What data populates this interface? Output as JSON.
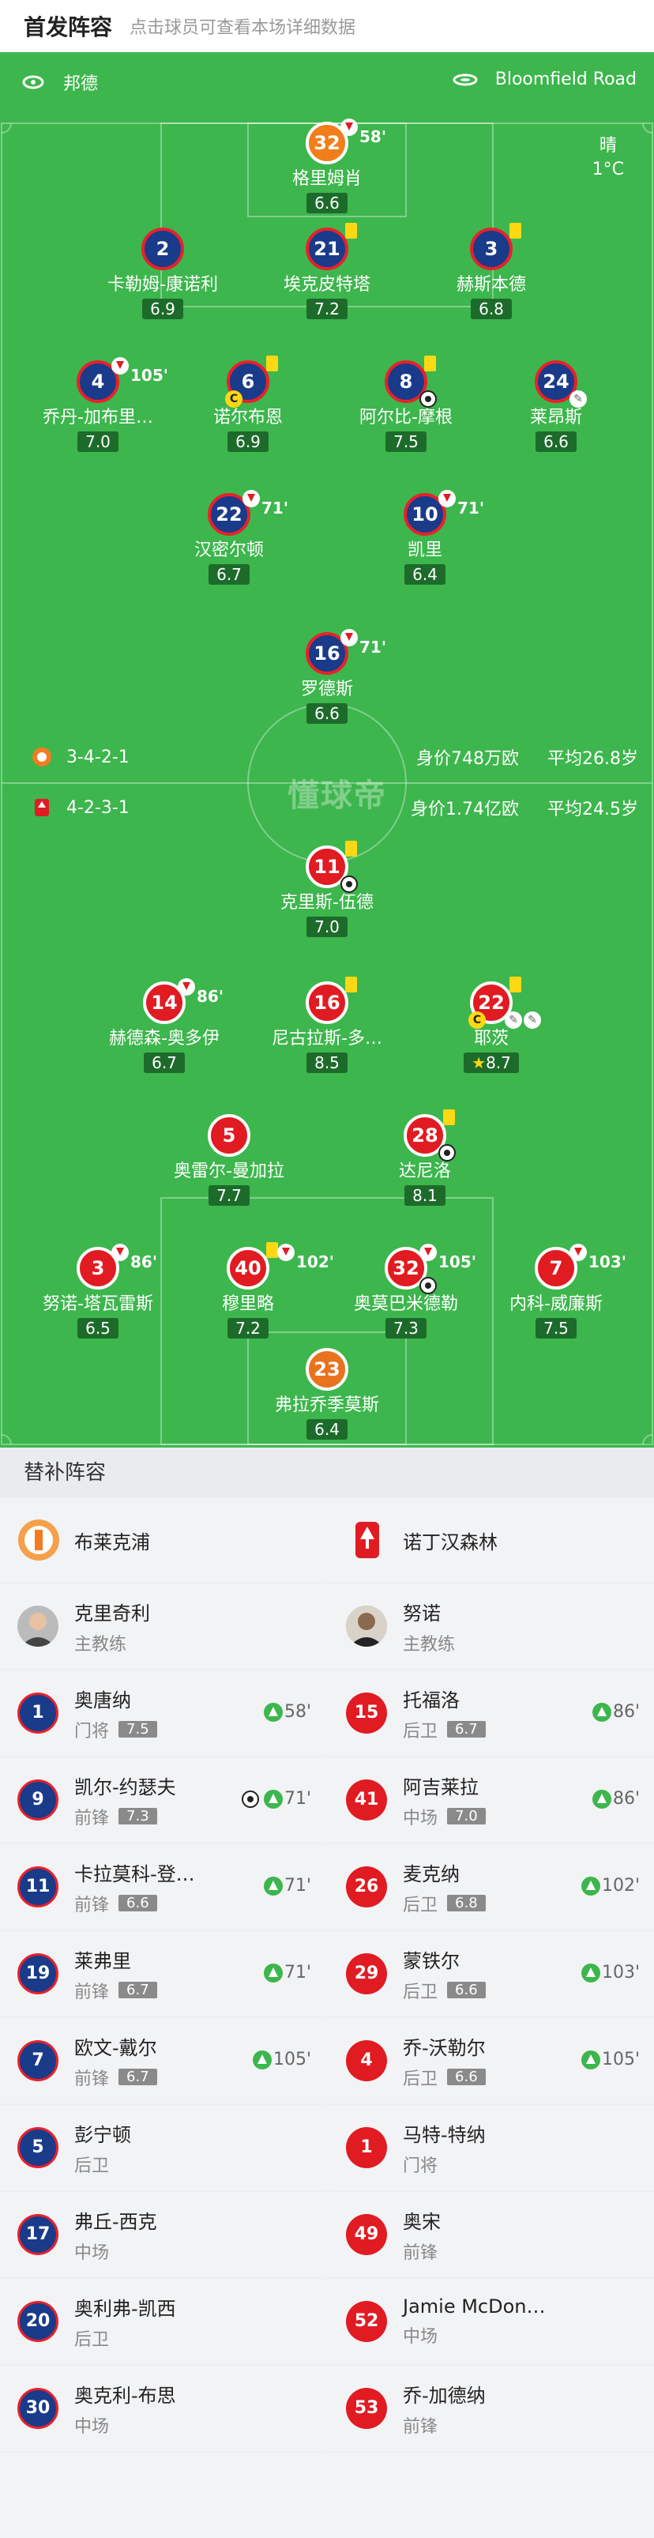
{
  "header": {
    "title": "首发阵容",
    "hint": "点击球员可查看本场详细数据"
  },
  "pitch": {
    "left_venue": "邦德",
    "right_venue": "Bloomfield Road",
    "weather": "晴",
    "temp": "1°C",
    "watermark": "懂球帝"
  },
  "teams_summary": [
    {
      "formation": "3-4-2-1",
      "value": "身价748万欧",
      "avg": "平均26.8岁"
    },
    {
      "formation": "4-2-3-1",
      "value": "身价1.74亿欧",
      "avg": "平均24.5岁"
    }
  ],
  "home": [
    {
      "num": "32",
      "name": "格里姆肖",
      "rating": "6.6",
      "sub": "58'"
    },
    {
      "num": "2",
      "name": "卡勒姆-康诺利",
      "rating": "6.9"
    },
    {
      "num": "21",
      "name": "埃克皮特塔",
      "rating": "7.2"
    },
    {
      "num": "3",
      "name": "赫斯本德",
      "rating": "6.8"
    },
    {
      "num": "4",
      "name": "乔丹-加布里…",
      "rating": "7.0",
      "sub": "105'"
    },
    {
      "num": "6",
      "name": "诺尔布恩",
      "rating": "6.9"
    },
    {
      "num": "8",
      "name": "阿尔比-摩根",
      "rating": "7.5"
    },
    {
      "num": "24",
      "name": "莱昂斯",
      "rating": "6.6"
    },
    {
      "num": "22",
      "name": "汉密尔顿",
      "rating": "6.7",
      "sub": "71'"
    },
    {
      "num": "10",
      "name": "凯里",
      "rating": "6.4",
      "sub": "71'"
    },
    {
      "num": "16",
      "name": "罗德斯",
      "rating": "6.6",
      "sub": "71'"
    }
  ],
  "away": [
    {
      "num": "11",
      "name": "克里斯-伍德",
      "rating": "7.0"
    },
    {
      "num": "14",
      "name": "赫德森-奥多伊",
      "rating": "6.7",
      "sub": "86'"
    },
    {
      "num": "16",
      "name": "尼古拉斯-多…",
      "rating": "8.5"
    },
    {
      "num": "22",
      "name": "耶茨",
      "rating": "8.7"
    },
    {
      "num": "5",
      "name": "奥雷尔-曼加拉",
      "rating": "7.7"
    },
    {
      "num": "28",
      "name": "达尼洛",
      "rating": "8.1"
    },
    {
      "num": "3",
      "name": "努诺-塔瓦雷斯",
      "rating": "6.5",
      "sub": "86'"
    },
    {
      "num": "40",
      "name": "穆里略",
      "rating": "7.2",
      "sub": "102'"
    },
    {
      "num": "32",
      "name": "奥莫巴米德勒",
      "rating": "7.3",
      "sub": "105'"
    },
    {
      "num": "7",
      "name": "内科-威廉斯",
      "rating": "7.5",
      "sub": "103'"
    },
    {
      "num": "23",
      "name": "弗拉乔季莫斯",
      "rating": "6.4"
    }
  ],
  "subs_title": "替补阵容",
  "left_team": {
    "name": "布莱克浦",
    "coach": "克里奇利",
    "coach_role": "主教练",
    "subs": [
      {
        "num": "1",
        "name": "奥唐纳",
        "pos": "门将",
        "rating": "7.5",
        "time": "58'"
      },
      {
        "num": "9",
        "name": "凯尔-约瑟夫",
        "pos": "前锋",
        "rating": "7.3",
        "time": "71'"
      },
      {
        "num": "11",
        "name": "卡拉莫科-登…",
        "pos": "前锋",
        "rating": "6.6",
        "time": "71'"
      },
      {
        "num": "19",
        "name": "莱弗里",
        "pos": "前锋",
        "rating": "6.7",
        "time": "71'"
      },
      {
        "num": "7",
        "name": "欧文-戴尔",
        "pos": "前锋",
        "rating": "6.7",
        "time": "105'"
      },
      {
        "num": "5",
        "name": "彭宁顿",
        "pos": "后卫"
      },
      {
        "num": "17",
        "name": "弗丘-西克",
        "pos": "中场"
      },
      {
        "num": "20",
        "name": "奥利弗-凯西",
        "pos": "后卫"
      },
      {
        "num": "30",
        "name": "奥克利-布思",
        "pos": "中场"
      }
    ]
  },
  "right_team": {
    "name": "诺丁汉森林",
    "coach": "努诺",
    "coach_role": "主教练",
    "subs": [
      {
        "num": "15",
        "name": "托福洛",
        "pos": "后卫",
        "rating": "6.7",
        "time": "86'"
      },
      {
        "num": "41",
        "name": "阿吉莱拉",
        "pos": "中场",
        "rating": "7.0",
        "time": "86'"
      },
      {
        "num": "26",
        "name": "麦克纳",
        "pos": "后卫",
        "rating": "6.8",
        "time": "102'"
      },
      {
        "num": "29",
        "name": "蒙铁尔",
        "pos": "后卫",
        "rating": "6.6",
        "time": "103'"
      },
      {
        "num": "4",
        "name": "乔-沃勒尔",
        "pos": "后卫",
        "rating": "6.6",
        "time": "105'"
      },
      {
        "num": "1",
        "name": "马特-特纳",
        "pos": "门将"
      },
      {
        "num": "49",
        "name": "奥宋",
        "pos": "前锋"
      },
      {
        "num": "52",
        "name": "Jamie McDon…",
        "pos": "中场"
      },
      {
        "num": "53",
        "name": "乔-加德纳",
        "pos": "前锋"
      }
    ]
  }
}
